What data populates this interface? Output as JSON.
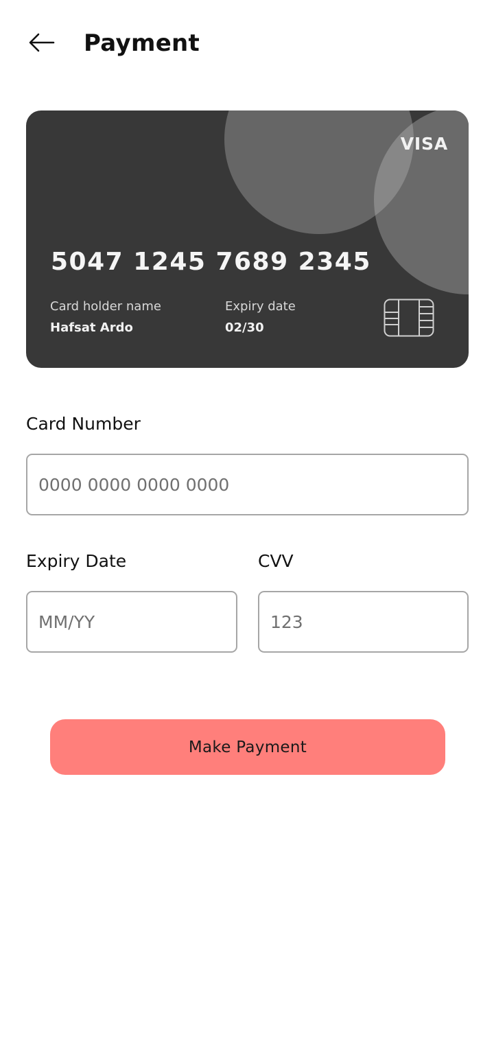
{
  "header": {
    "back_icon": "arrow-left-icon",
    "title": "Payment"
  },
  "card": {
    "brand": "VISA",
    "number": "5047 1245 7689 2345",
    "holder_label": "Card holder name",
    "holder_value": "Hafsat Ardo",
    "expiry_label": "Expiry date",
    "expiry_value": "02/30",
    "chip_icon": "card-chip-icon",
    "colors": {
      "base": "#383838",
      "circle_1": "#666666",
      "circle_2": "#808080"
    }
  },
  "form": {
    "card_number": {
      "label": "Card Number",
      "value": "",
      "placeholder": "0000 0000 0000 0000"
    },
    "expiry": {
      "label": "Expiry Date",
      "value": "",
      "placeholder": "MM/YY"
    },
    "cvv": {
      "label": "CVV",
      "value": "",
      "placeholder": "123"
    }
  },
  "actions": {
    "submit_label": "Make Payment",
    "submit_color": "#ff7f7b"
  }
}
